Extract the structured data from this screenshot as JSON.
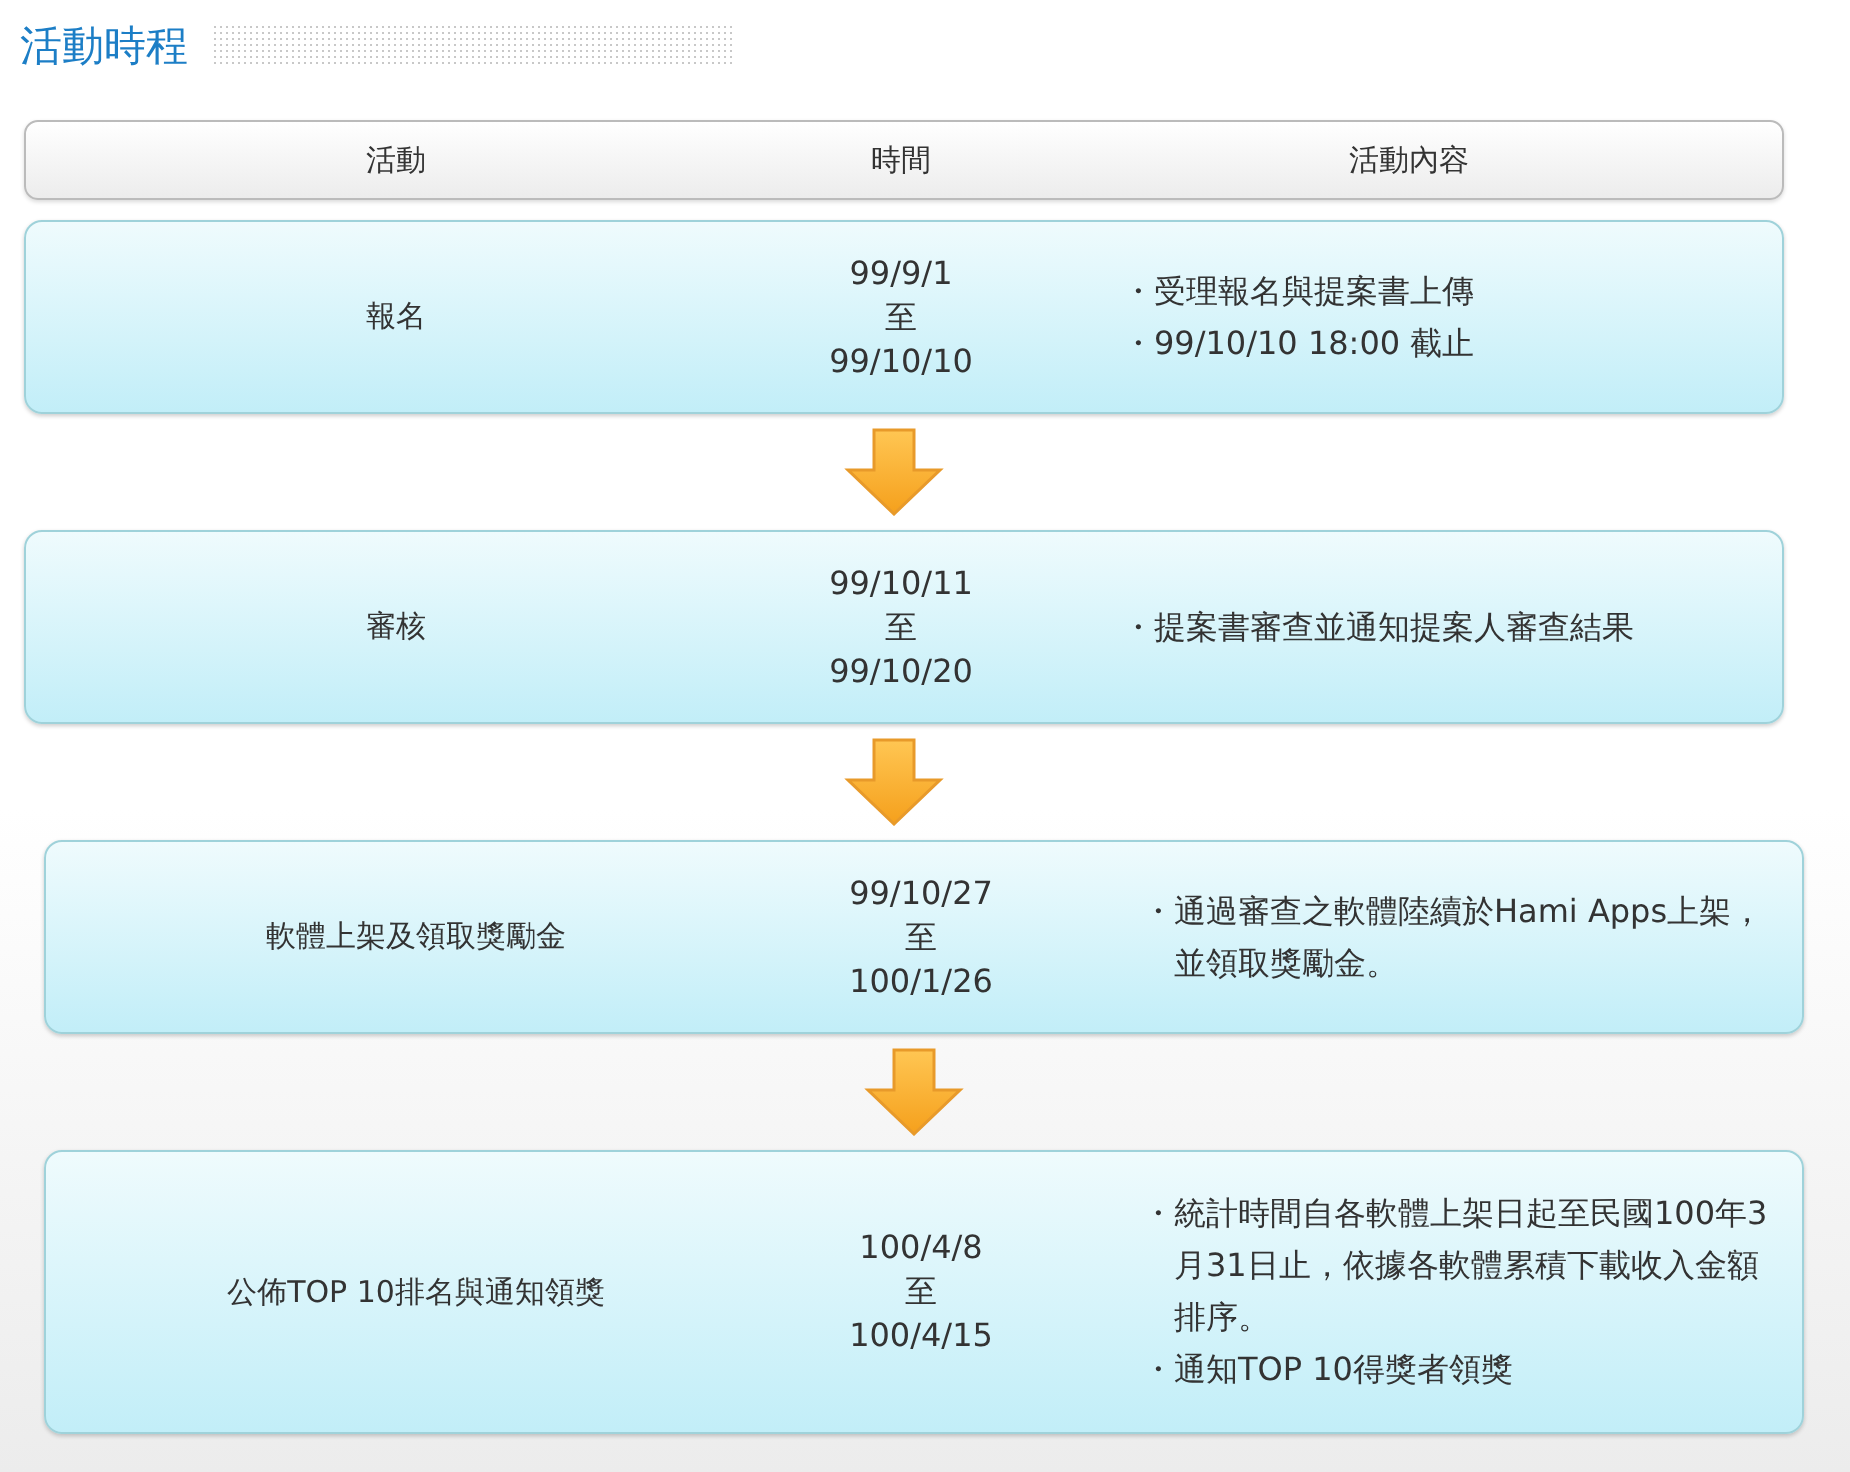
{
  "title": "活動時程",
  "columns": [
    "活動",
    "時間",
    "活動內容"
  ],
  "steps": [
    {
      "activity": "報名",
      "time": [
        "99/9/1",
        "至",
        "99/10/10"
      ],
      "details": [
        "・受理報名與提案書上傳",
        "・99/10/10 18:00 截止"
      ]
    },
    {
      "activity": "審核",
      "time": [
        "99/10/11",
        "至",
        "99/10/20"
      ],
      "details": [
        "・提案書審查並通知提案人審查結果"
      ]
    },
    {
      "activity": "軟體上架及領取獎勵金",
      "time": [
        "99/10/27",
        "至",
        "100/1/26"
      ],
      "details": [
        "・通過審查之軟體陸續於Hami Apps上架，並領取獎勵金。"
      ]
    },
    {
      "activity": "公佈TOP 10排名與通知領獎",
      "time": [
        "100/4/8",
        "至",
        "100/4/15"
      ],
      "details": [
        "・統計時間自各軟體上架日起至民國100年3月31日止，依據各軟體累積下載收入金額排序。",
        "・通知TOP 10得獎者領獎"
      ]
    }
  ]
}
